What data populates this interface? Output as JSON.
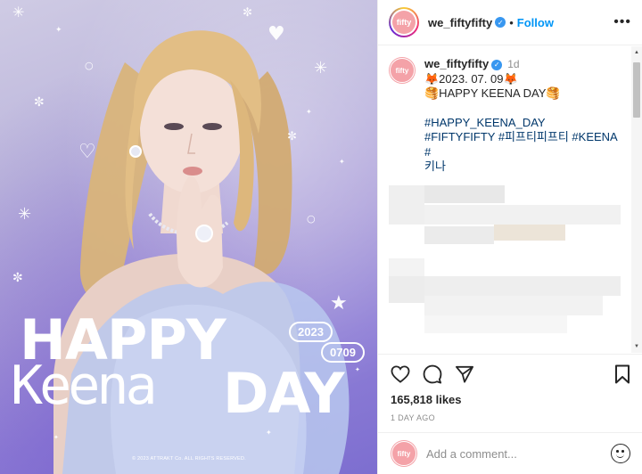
{
  "post": {
    "image": {
      "headline_line1": "HAPPY",
      "headline_keena": "Keena",
      "headline_day": "DAY",
      "year_pill": "2023",
      "date_pill": "0709",
      "copyright": "© 2023 ATTRAKT Co. ALL RIGHTS RESERVED."
    },
    "header": {
      "username": "we_fiftyfifty",
      "separator": "•",
      "follow_label": "Follow",
      "more_label": "•••"
    },
    "caption": {
      "username": "we_fiftyfifty",
      "time": "1d",
      "line1": "🦊2023. 07. 09🦊",
      "line2": "🥞HAPPY KEENA DAY🥞",
      "tag1": "#HAPPY_KEENA_DAY",
      "tag2": "#FIFTYFIFTY #피프티피프티 #KEENA #",
      "tag3": "키나"
    },
    "likes": "165,818 likes",
    "posted_ago": "1 DAY AGO",
    "comment_input_placeholder": "Add a comment...",
    "logo_text": "fifty"
  }
}
